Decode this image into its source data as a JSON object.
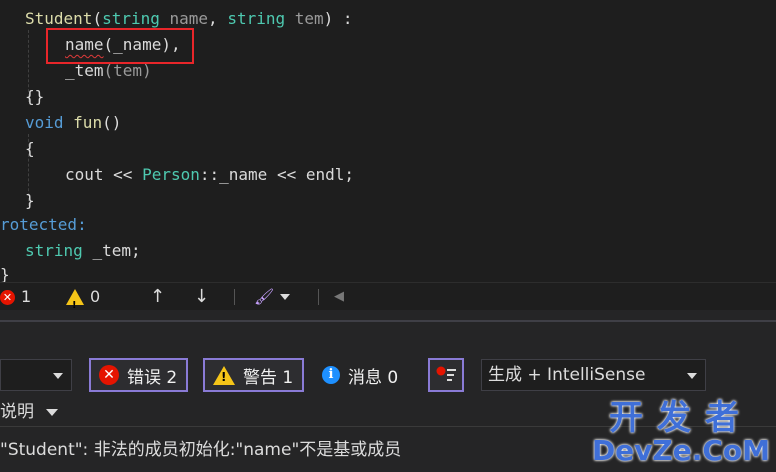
{
  "code": {
    "l1": {
      "ctor": "Student",
      "p1type": "string",
      "p1name": "name",
      "p2type": "string",
      "p2name": "tem",
      "colon": ":"
    },
    "l2": {
      "member": "name",
      "arg": "(_name),"
    },
    "l3": {
      "member": "_tem",
      "arg": "(tem)"
    },
    "l4": {
      "braces": "{}"
    },
    "l5": {
      "ret": "void",
      "fn": "fun",
      "parens": "()"
    },
    "l6": {
      "open": "{"
    },
    "l7": {
      "cout": "cout",
      "op1": "<<",
      "cls": "Person",
      "scope": "::_name",
      "op2": "<<",
      "endl": "endl;"
    },
    "l8": {
      "close": "}"
    },
    "l9": {
      "access": "rotected:"
    },
    "l10": {
      "type": "string",
      "name": "_tem;"
    },
    "l11": {
      "close": "}"
    }
  },
  "statusbar": {
    "errors": "1",
    "warnings": "0",
    "up": "↑",
    "down": "↓",
    "brush": "🖌",
    "left": "◀"
  },
  "error_list": {
    "errors_label": "错误 2",
    "warnings_label": "警告 1",
    "messages_label": "消息 0",
    "build_filter": "生成 + IntelliSense",
    "column_description": "说明",
    "rows": [
      "\"Student\": 非法的成员初始化:\"name\"不是基或成员"
    ]
  },
  "watermark": {
    "top": "开发者",
    "bottom": "DevZe.CoM"
  },
  "colors": {
    "error": "#e51400",
    "warning": "#f5c518",
    "info": "#1e90ff",
    "highlight": "#e8262a",
    "filter_border": "#8a7bd6"
  }
}
